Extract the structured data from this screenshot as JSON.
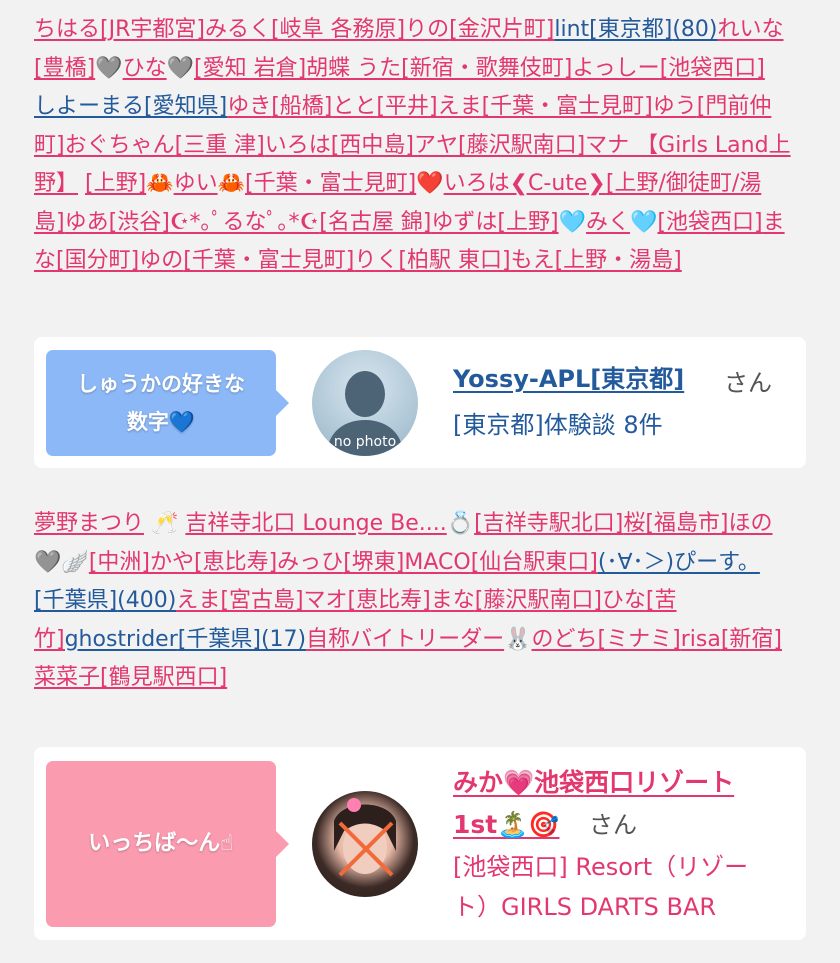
{
  "top_list": {
    "l1_a": "ちはる",
    "l1_b": "[JR宇都宮]",
    "l1_c": "みるく",
    "l1_d": "[岐阜 各務原]",
    "l1_e": "りの",
    "l1_f": "[金沢片町]",
    "l1_g": "lint",
    "l1_h": "[東京都]",
    "l1_i": "(80)",
    "l1_j": "れいな",
    "l2_a": "[豊橋]",
    "l2_b": "ひな",
    "l2_c": "[愛知 岩倉]",
    "l2_d": "胡蝶 うた",
    "l2_e": "[新宿・歌舞伎町]",
    "l2_f": "よっしー",
    "l2_g": "[池袋西口]",
    "l3_a": "しよーまる",
    "l3_b": "[愛知県]",
    "l3_c": "ゆき",
    "l3_d": "[船橋]",
    "l3_e": "とと",
    "l3_f": "[平井]",
    "l3_g": "えま",
    "l3_h": "[千葉・富士見町]",
    "l3_i": "ゆう",
    "l3_j": "[門前仲",
    "l4_a": "町]",
    "l4_b": "おぐちゃん",
    "l4_c": "[三重 津]",
    "l4_d": "いろは",
    "l4_e": "[西中島]",
    "l4_f": "アヤ",
    "l4_g": "[藤沢駅南口]",
    "l4_h": "マナ 【Girls Land上",
    "l5_a": "野】",
    "l5_b": "[上野]",
    "l5_c": "ゆい",
    "l5_d": "[千葉・富士見町]",
    "l5_e": "いろは❮C-ute❯",
    "l5_f": "[上野/御徒町/湯",
    "l6_a": "島]",
    "l6_b": "ゆあ",
    "l6_c": "[渋谷]",
    "l6_d": "☪︎*｡ﾟるなﾟ｡*☪︎",
    "l6_e": "[名古屋 錦]",
    "l6_f": "ゆずは",
    "l6_g": "[上野]",
    "l6_h": "みく",
    "l6_i": "[池袋西口]",
    "l6_j": "ま",
    "l7_a": "な",
    "l7_b": "[国分町]",
    "l7_c": "ゆの",
    "l7_d": "[千葉・富士見町]",
    "l7_e": "りく",
    "l7_f": "[柏駅 東口]",
    "l7_g": "もえ",
    "l7_h": "[上野・湯島]"
  },
  "card1": {
    "bubble_line1": "しゅうかの好きな",
    "bubble_line2": "数字",
    "bubble_emoji": "💙",
    "avatar_text": "no photo",
    "name": "Yossy-APL[東京都]",
    "san": "さん",
    "desc": "[東京都]体験談 8件",
    "bubble_color": "#8cb8f7",
    "name_color": "#235a9c"
  },
  "mid_list": {
    "l1_a": "夢野まつり",
    "l1_b": "吉祥寺北口 Lounge Be....",
    "l1_c": "[吉祥寺駅北口]",
    "l1_d": "桜",
    "l1_e": "[福島市]",
    "l1_f": "ほの",
    "l2_a": "[中洲]",
    "l2_b": "かや",
    "l2_c": "[恵比寿]",
    "l2_d": "みっひ",
    "l2_e": "[堺東]",
    "l2_f": "MACO",
    "l2_g": "[仙台駅東口]",
    "l2_h": "(･∀･＞)ぴーす。",
    "l3_a": "[千葉県]",
    "l3_b": "(400)",
    "l3_c": "えま",
    "l3_d": "[宮古島]",
    "l3_e": "マオ",
    "l3_f": "[恵比寿]",
    "l3_g": "まな",
    "l3_h": "[藤沢駅南口]",
    "l3_i": "ひな",
    "l3_j": "[苦",
    "l4_a": "竹]",
    "l4_b": "ghostrider",
    "l4_c": "[千葉県]",
    "l4_d": "(17)",
    "l4_e": "自称バイトリーダー",
    "l4_f": "のどち",
    "l4_g": "[ミナミ]",
    "l4_h": "risa",
    "l4_i": "[新宿]",
    "l5_a": "菜菜子",
    "l5_b": "[鶴見駅西口]"
  },
  "card2": {
    "bubble_text": "いっちば〜ん",
    "bubble_emoji": "☝",
    "name_line1": "みか💗池袋西口リゾート",
    "name_line2": "1st🏝️🎯",
    "san": "さん",
    "desc_line1": "[池袋西口] Resort（リゾー",
    "desc_line2": "ト）GIRLS DARTS BAR",
    "bubble_color": "#fb9bb0",
    "name_color": "#e2386f"
  },
  "emoji": {
    "grey_heart": "🩶",
    "crab": "🦀",
    "red_heart": "❤️",
    "cyan_heart": "🩵",
    "champagne": "🥂",
    "ring": "💍",
    "wing": "🪽",
    "rabbit": "🐰"
  }
}
